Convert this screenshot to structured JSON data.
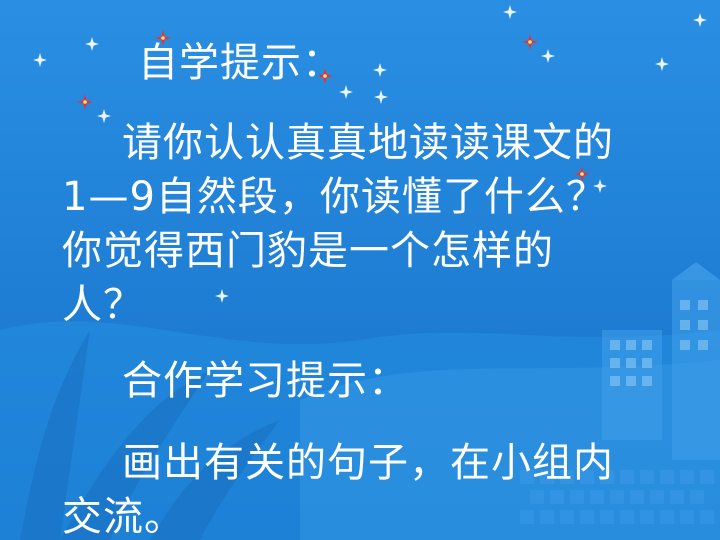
{
  "slide": {
    "heading_self_study": "自学提示：",
    "self_study_lines": [
      "请你认认真真地读读课文的",
      "1—9自然段，你读懂了什么？",
      "你觉得西门豹是一个怎样的",
      "人？"
    ],
    "heading_cooperative": "合作学习提示：",
    "cooperative_lines": [
      "画出有关的句子，在小组内",
      "交流。"
    ]
  },
  "colors": {
    "background": "#1e7fd6",
    "text": "#ffffff",
    "star_red": "#e8332a"
  }
}
